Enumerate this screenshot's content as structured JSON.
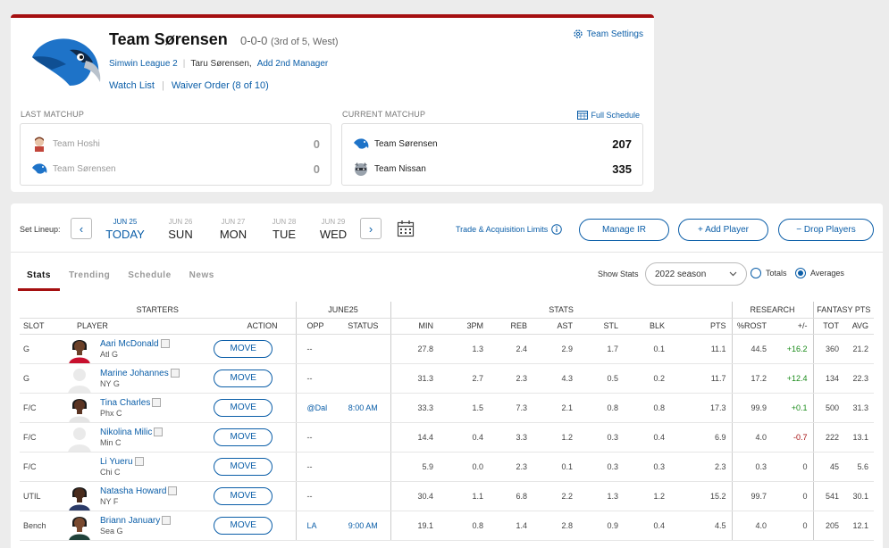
{
  "team": {
    "name": "Team Sørensen",
    "record": "0-0-0",
    "rank": "(3rd of 5, West)",
    "settings_label": "Team Settings",
    "league": "Simwin League 2",
    "owner": "Taru Sørensen,",
    "add_manager": "Add 2nd Manager",
    "watch_list": "Watch List",
    "waiver_order": "Waiver Order (8 of 10)"
  },
  "last_matchup": {
    "label": "LAST MATCHUP",
    "teams": [
      {
        "name": "Team Hoshi",
        "score": "0"
      },
      {
        "name": "Team Sørensen",
        "score": "0"
      }
    ]
  },
  "current_matchup": {
    "label": "CURRENT MATCHUP",
    "full_schedule": "Full Schedule",
    "teams": [
      {
        "name": "Team Sørensen",
        "score": "207"
      },
      {
        "name": "Team Nissan",
        "score": "335"
      }
    ]
  },
  "lineup": {
    "label": "Set Lineup:",
    "days": [
      {
        "date": "JUN 25",
        "name": "TODAY"
      },
      {
        "date": "JUN 26",
        "name": "SUN"
      },
      {
        "date": "JUN 27",
        "name": "MON"
      },
      {
        "date": "JUN 28",
        "name": "TUE"
      },
      {
        "date": "JUN 29",
        "name": "WED"
      }
    ],
    "trade_limits": "Trade & Acquisition Limits",
    "manage_ir": "Manage IR",
    "add_player": "+ Add Player",
    "drop_players": "− Drop Players"
  },
  "tabs": [
    "Stats",
    "Trending",
    "Schedule",
    "News"
  ],
  "stats_controls": {
    "show_stats": "Show Stats",
    "season": "2022 season",
    "totals": "Totals",
    "averages": "Averages"
  },
  "table": {
    "groups": {
      "starters": "STARTERS",
      "date": "JUNE25",
      "stats": "STATS",
      "research": "RESEARCH",
      "fantasy": "FANTASY PTS"
    },
    "columns": {
      "slot": "SLOT",
      "player": "PLAYER",
      "action": "ACTION",
      "opp": "OPP",
      "status": "STATUS",
      "min": "MIN",
      "tpm": "3PM",
      "reb": "REB",
      "ast": "AST",
      "stl": "STL",
      "blk": "BLK",
      "pts": "PTS",
      "rost": "%ROST",
      "pm": "+/-",
      "tot": "TOT",
      "avg": "AVG"
    },
    "move_label": "MOVE",
    "rows": [
      {
        "slot": "G",
        "name": "Aari McDonald",
        "team": "Atl G",
        "opp": "--",
        "status": "",
        "min": "27.8",
        "tpm": "1.3",
        "reb": "2.4",
        "ast": "2.9",
        "stl": "1.7",
        "blk": "0.1",
        "pts": "11.1",
        "rost": "44.5",
        "pm": "+16.2",
        "tot": "360",
        "avg": "21.2"
      },
      {
        "slot": "G",
        "name": "Marine Johannes",
        "team": "NY G",
        "opp": "--",
        "status": "",
        "min": "31.3",
        "tpm": "2.7",
        "reb": "2.3",
        "ast": "4.3",
        "stl": "0.5",
        "blk": "0.2",
        "pts": "11.7",
        "rost": "17.2",
        "pm": "+12.4",
        "tot": "134",
        "avg": "22.3"
      },
      {
        "slot": "F/C",
        "name": "Tina Charles",
        "team": "Phx C",
        "opp": "@Dal",
        "status": "8:00 AM",
        "min": "33.3",
        "tpm": "1.5",
        "reb": "7.3",
        "ast": "2.1",
        "stl": "0.8",
        "blk": "0.8",
        "pts": "17.3",
        "rost": "99.9",
        "pm": "+0.1",
        "tot": "500",
        "avg": "31.3"
      },
      {
        "slot": "F/C",
        "name": "Nikolina Milic",
        "team": "Min C",
        "opp": "--",
        "status": "",
        "min": "14.4",
        "tpm": "0.4",
        "reb": "3.3",
        "ast": "1.2",
        "stl": "0.3",
        "blk": "0.4",
        "pts": "6.9",
        "rost": "4.0",
        "pm": "-0.7",
        "tot": "222",
        "avg": "13.1"
      },
      {
        "slot": "F/C",
        "name": "Li Yueru",
        "team": "Chi C",
        "opp": "--",
        "status": "",
        "min": "5.9",
        "tpm": "0.0",
        "reb": "2.3",
        "ast": "0.1",
        "stl": "0.3",
        "blk": "0.3",
        "pts": "2.3",
        "rost": "0.3",
        "pm": "0",
        "tot": "45",
        "avg": "5.6"
      },
      {
        "slot": "UTIL",
        "name": "Natasha Howard",
        "team": "NY F",
        "opp": "--",
        "status": "",
        "min": "30.4",
        "tpm": "1.1",
        "reb": "6.8",
        "ast": "2.2",
        "stl": "1.3",
        "blk": "1.2",
        "pts": "15.2",
        "rost": "99.7",
        "pm": "0",
        "tot": "541",
        "avg": "30.1"
      },
      {
        "slot": "Bench",
        "name": "Briann January",
        "team": "Sea G",
        "opp": "LA",
        "status": "9:00 AM",
        "min": "19.1",
        "tpm": "0.8",
        "reb": "1.4",
        "ast": "2.8",
        "stl": "0.9",
        "blk": "0.4",
        "pts": "4.5",
        "rost": "4.0",
        "pm": "0",
        "tot": "205",
        "avg": "12.1"
      }
    ]
  },
  "colors": {
    "accent": "#a50f10",
    "link": "#0b5ea8",
    "positive": "#1a8b1a",
    "negative": "#a50f10"
  }
}
